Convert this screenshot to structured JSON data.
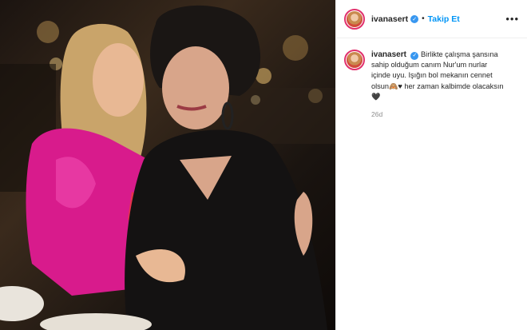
{
  "post": {
    "username": "ivanasert",
    "verified_symbol": "✓",
    "separator": "•",
    "follow_label": "Takip Et",
    "more_symbol": "•••",
    "caption": "Birlikte çalışma şansına sahip olduğum canım Nur'um nurlar içinde uyu. Işığın bol mekanın cennet olsun🙈♥ her zaman kalbimde olacaksın 🖤",
    "time_ago": "26d"
  },
  "colors": {
    "accent": "#0095f6",
    "verified": "#3897f0",
    "ring": "#e1306c"
  },
  "icons": [
    "verified-badge-icon",
    "more-options-icon"
  ]
}
